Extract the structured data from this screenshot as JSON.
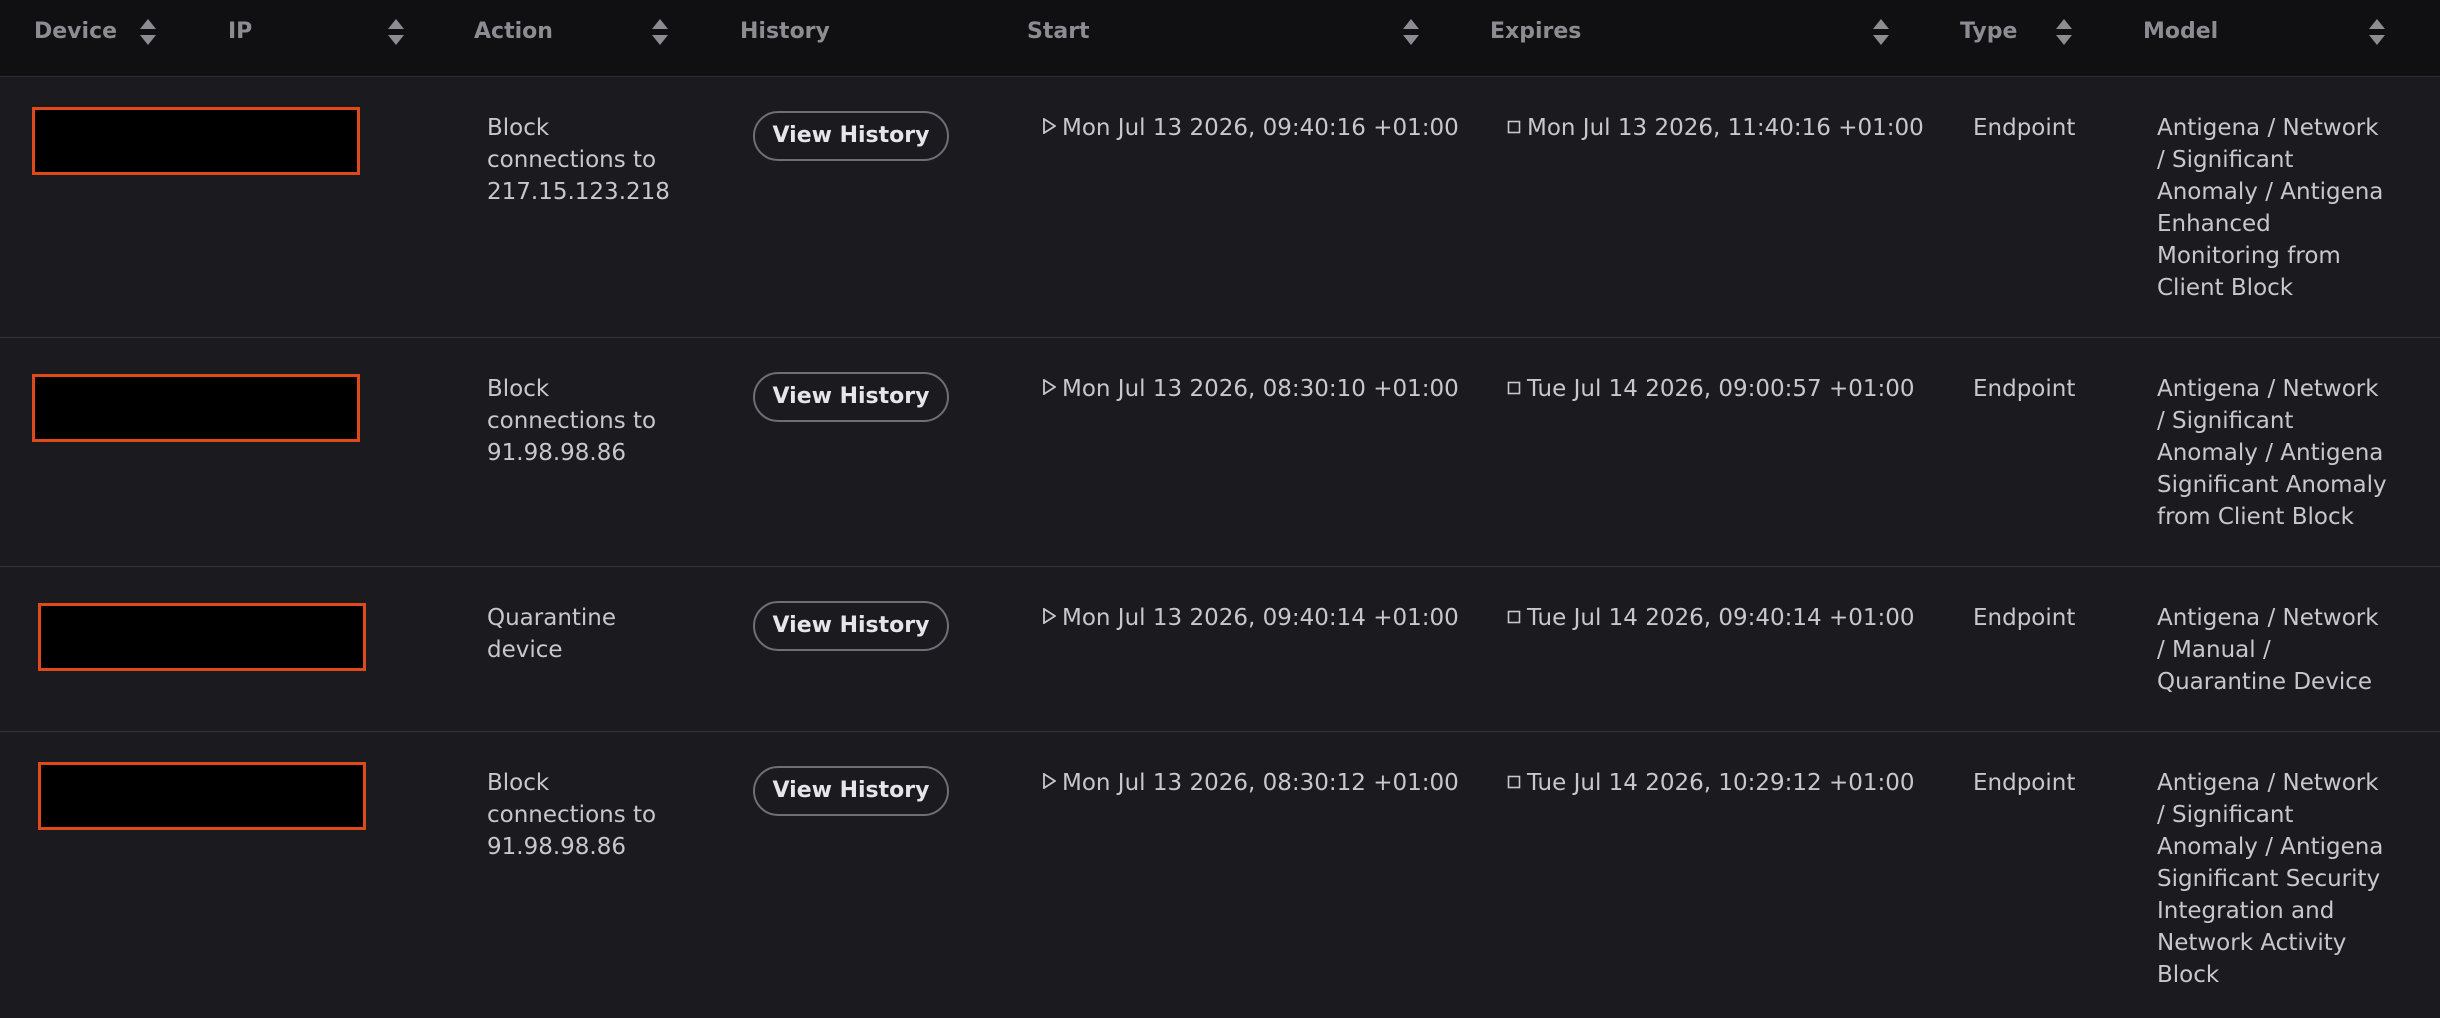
{
  "columns": {
    "device": "Device",
    "ip": "IP",
    "action": "Action",
    "history": "History",
    "start": "Start",
    "expires": "Expires",
    "type": "Type",
    "model": "Model"
  },
  "rows": [
    {
      "action_lines": [
        "Block",
        "connections to",
        "217.15.123.218"
      ],
      "history_label": "View History",
      "start": "Mon Jul 13 2026, 09:40:16 +01:00",
      "expires": "Mon Jul 13 2026, 11:40:16 +01:00",
      "type": "Endpoint",
      "model_lines": [
        "Antigena / Network",
        "/ Significant",
        "Anomaly / Antigena",
        "Enhanced",
        "Monitoring from",
        "Client Block"
      ]
    },
    {
      "action_lines": [
        "Block",
        "connections to",
        "91.98.98.86"
      ],
      "history_label": "View History",
      "start": "Mon Jul 13 2026, 08:30:10 +01:00",
      "expires": "Tue Jul 14 2026, 09:00:57 +01:00",
      "type": "Endpoint",
      "model_lines": [
        "Antigena / Network",
        "/ Significant",
        "Anomaly / Antigena",
        "Significant Anomaly",
        "from Client Block"
      ]
    },
    {
      "action_lines": [
        "Quarantine",
        "device"
      ],
      "history_label": "View History",
      "start": "Mon Jul 13 2026, 09:40:14 +01:00",
      "expires": "Tue Jul 14 2026, 09:40:14 +01:00",
      "type": "Endpoint",
      "model_lines": [
        "Antigena / Network",
        "/ Manual /",
        "Quarantine Device"
      ]
    },
    {
      "action_lines": [
        "Block",
        "connections to",
        "91.98.98.86"
      ],
      "history_label": "View History",
      "start": "Mon Jul 13 2026, 08:30:12 +01:00",
      "expires": "Tue Jul 14 2026, 10:29:12 +01:00",
      "type": "Endpoint",
      "model_lines": [
        "Antigena / Network",
        "/ Significant",
        "Anomaly / Antigena",
        "Significant Security",
        "Integration and",
        "Network Activity",
        "Block"
      ]
    }
  ],
  "icons": {
    "sort": "sort-icon",
    "start": "play-icon",
    "expires": "stop-icon"
  },
  "colors": {
    "background": "#1a1a1f",
    "header_background": "#101013",
    "redaction_border": "#e0491c"
  }
}
